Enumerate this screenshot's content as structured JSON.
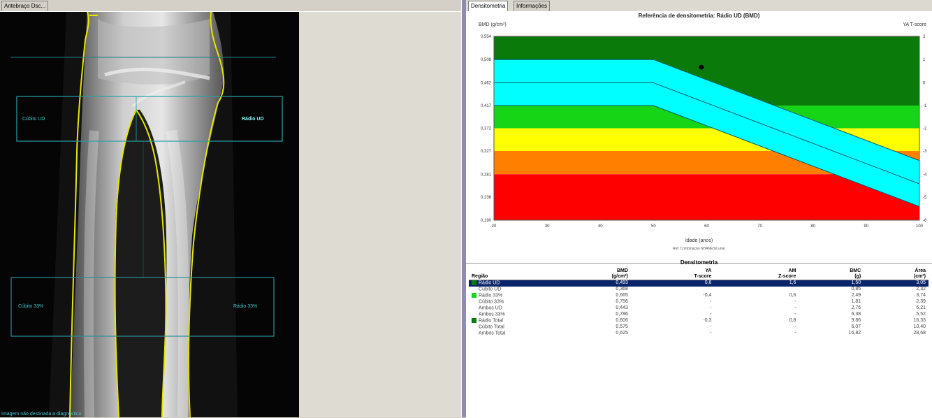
{
  "left": {
    "tab_label": "Antebraço Dsc..."
  },
  "xray": {
    "roi_labels": {
      "cubito_ud": "Cúbito UD",
      "radio_ud": "Rádio UD",
      "cubito_33": "Cúbito 33%",
      "radio_33": "Rádio 33%"
    },
    "footer": "Imagem não destinada a diagnóstico"
  },
  "right": {
    "tabs": [
      "Densitometria",
      "Informações"
    ]
  },
  "chart_data": {
    "type": "area",
    "title": "Referência de densitometria: Rádio UD (BMD)",
    "ylabel": "BMD (g/cm²)",
    "y2label": "YA T-score",
    "xlabel": "Idade (anos)",
    "source": "Ref: Combinação NHANES/Lunar",
    "xlim": [
      20,
      100
    ],
    "x_ticks": [
      20,
      30,
      40,
      50,
      60,
      70,
      80,
      90,
      100
    ],
    "y_ticks": [
      "0,554",
      "0,508",
      "0,462",
      "0,417",
      "0,372",
      "0,327",
      "0,281",
      "0,236",
      "0,190"
    ],
    "t_ticks": [
      "2",
      "1",
      "0",
      "-1",
      "-2",
      "-3",
      "-4",
      "-5",
      "-6"
    ],
    "bands": [
      {
        "name": "green-dark",
        "color": "#0a7a0a",
        "range": [
          0.417,
          0.554
        ]
      },
      {
        "name": "green",
        "color": "#16d416",
        "range": [
          0.372,
          0.417
        ]
      },
      {
        "name": "yellow",
        "color": "#ffff00",
        "range": [
          0.327,
          0.372
        ]
      },
      {
        "name": "orange",
        "color": "#ff8000",
        "range": [
          0.281,
          0.327
        ]
      },
      {
        "name": "red",
        "color": "#ff0000",
        "range": [
          0.19,
          0.281
        ]
      }
    ],
    "reference_band": {
      "color": "#00ffff",
      "x": [
        20,
        50,
        100
      ],
      "upper": [
        0.508,
        0.508,
        0.308
      ],
      "mean": [
        0.462,
        0.462,
        0.262
      ],
      "lower": [
        0.417,
        0.417,
        0.217
      ]
    },
    "patient_point": {
      "age": 59,
      "bmd": 0.493
    }
  },
  "table": {
    "title": "Densitometria",
    "headers": [
      {
        "top": "Região",
        "bottom": ""
      },
      {
        "top": "BMD",
        "bottom": "(g/cm²)"
      },
      {
        "top": "YA",
        "bottom": "T-score"
      },
      {
        "top": "AM",
        "bottom": "Z-score"
      },
      {
        "top": "BMC",
        "bottom": "(g)"
      },
      {
        "top": "Área",
        "bottom": "(cm²)"
      }
    ],
    "rows": [
      {
        "region": "Rádio UD",
        "bmd": "0,493",
        "ya": "0,6",
        "am": "1,6",
        "bmc": "1,50",
        "area": "3,05",
        "selected": true,
        "marker": "#0a7a0a"
      },
      {
        "region": "Cúbito UD",
        "bmd": "0,368",
        "ya": "",
        "am": "",
        "bmc": "0,85",
        "area": "2,32",
        "selected": false,
        "marker": ""
      },
      {
        "region": "Rádio 33%",
        "bmd": "0,665",
        "ya": "-0,4",
        "am": "0,6",
        "bmc": "2,49",
        "area": "3,74",
        "selected": false,
        "marker": "#16d416"
      },
      {
        "region": "Cúbito 33%",
        "bmd": "0,756",
        "ya": "-",
        "am": "-",
        "bmc": "1,81",
        "area": "2,39",
        "selected": false,
        "marker": ""
      },
      {
        "region": "Ambos UD",
        "bmd": "0,443",
        "ya": "-",
        "am": "-",
        "bmc": "2,76",
        "area": "6,21",
        "selected": false,
        "marker": ""
      },
      {
        "region": "Ambos 33%",
        "bmd": "0,786",
        "ya": "-",
        "am": "-",
        "bmc": "6,38",
        "area": "5,52",
        "selected": false,
        "marker": ""
      },
      {
        "region": "Rádio Total",
        "bmd": "0,606",
        "ya": "-0,3",
        "am": "0,8",
        "bmc": "9,86",
        "area": "16,33",
        "selected": false,
        "marker": "#0a7a0a"
      },
      {
        "region": "Cúbito Total",
        "bmd": "0,575",
        "ya": "-",
        "am": "-",
        "bmc": "6,07",
        "area": "10,40",
        "selected": false,
        "marker": ""
      },
      {
        "region": "Ambos Total",
        "bmd": "0,625",
        "ya": "-",
        "am": "-",
        "bmc": "16,82",
        "area": "28,68",
        "selected": false,
        "marker": ""
      }
    ]
  }
}
